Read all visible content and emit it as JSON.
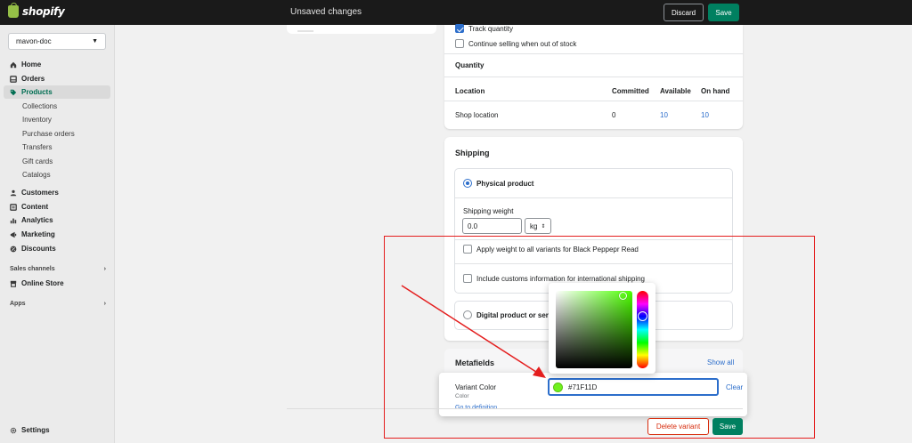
{
  "topbar": {
    "logo_text": "shopify",
    "status": "Unsaved changes",
    "discard_label": "Discard",
    "save_label": "Save"
  },
  "sidebar": {
    "store_name": "mavon-doc",
    "items": [
      {
        "label": "Home",
        "icon": "home-icon"
      },
      {
        "label": "Orders",
        "icon": "orders-icon"
      },
      {
        "label": "Products",
        "icon": "tag-icon",
        "active": true
      },
      {
        "label": "Customers",
        "icon": "person-icon"
      },
      {
        "label": "Content",
        "icon": "content-icon"
      },
      {
        "label": "Analytics",
        "icon": "analytics-icon"
      },
      {
        "label": "Marketing",
        "icon": "marketing-icon"
      },
      {
        "label": "Discounts",
        "icon": "discount-icon"
      }
    ],
    "product_sub_items": [
      "Collections",
      "Inventory",
      "Purchase orders",
      "Transfers",
      "Gift cards",
      "Catalogs"
    ],
    "sales_channels_label": "Sales channels",
    "online_store_label": "Online Store",
    "apps_label": "Apps",
    "settings_label": "Settings"
  },
  "inventory": {
    "track_quantity_label": "Track quantity",
    "track_quantity_checked": true,
    "continue_selling_label": "Continue selling when out of stock",
    "continue_selling_checked": false,
    "quantity_heading": "Quantity",
    "columns": [
      "Location",
      "Committed",
      "Available",
      "On hand"
    ],
    "rows": [
      {
        "location": "Shop location",
        "committed": "0",
        "available": "10",
        "on_hand": "10"
      }
    ]
  },
  "shipping": {
    "heading": "Shipping",
    "physical_label": "Physical product",
    "weight_label": "Shipping weight",
    "weight_value": "0.0",
    "weight_unit": "kg",
    "apply_weight_label": "Apply weight to all variants for Black Peppepr Read",
    "customs_label": "Include customs information for international shipping",
    "digital_label": "Digital product or serv"
  },
  "metafields": {
    "heading": "Metafields",
    "show_all_label": "Show all",
    "variant_color_label": "Variant Color",
    "type_label": "Color",
    "definition_link": "Go to definition",
    "color_value": "#71F11D",
    "clear_label": "Clear"
  },
  "footer": {
    "delete_label": "Delete variant",
    "save_label": "Save"
  },
  "colors": {
    "accent": "#008060",
    "highlight": "#e41e1e",
    "swatch": "#71F11D",
    "link": "#2c6ecb"
  }
}
